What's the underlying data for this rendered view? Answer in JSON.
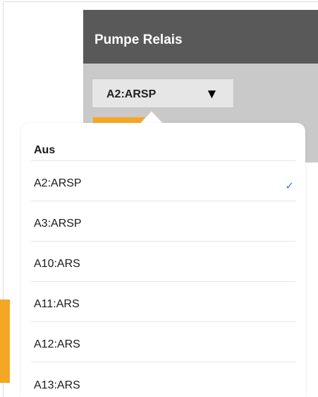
{
  "panel": {
    "title": "Pumpe Relais",
    "selected_value": "A2:ARSP",
    "dropdown_arrow": "▼"
  },
  "dropdown": {
    "header": "Aus",
    "options": [
      {
        "label": "A2:ARSP",
        "selected": true
      },
      {
        "label": "A3:ARSP",
        "selected": false
      },
      {
        "label": "A10:ARS",
        "selected": false
      },
      {
        "label": "A11:ARS",
        "selected": false
      },
      {
        "label": "A12:ARS",
        "selected": false
      },
      {
        "label": "A13:ARS",
        "selected": false
      }
    ],
    "check_glyph": "✓"
  },
  "colors": {
    "header_bg": "#595959",
    "body_bg": "#c9c9c9",
    "accent_orange": "#f5a623",
    "check_blue": "#2f80ed"
  },
  "icons": [
    "chevron-down-icon",
    "checkmark-icon"
  ]
}
